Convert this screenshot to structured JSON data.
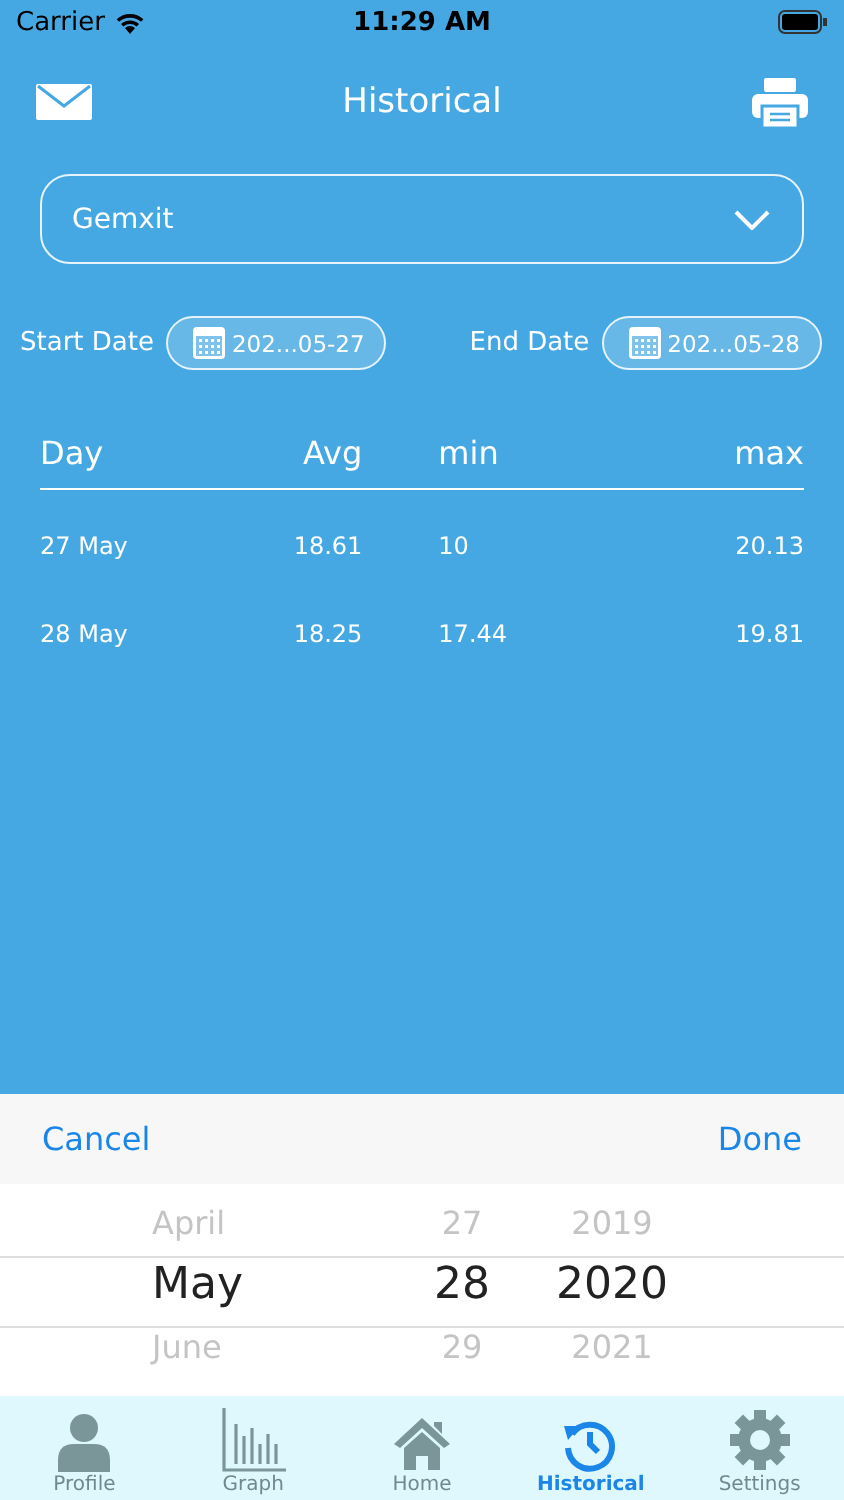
{
  "status_bar": {
    "carrier": "Carrier",
    "time": "11:29 AM"
  },
  "header": {
    "title": "Historical"
  },
  "sensor_dropdown": {
    "value": "Gemxit"
  },
  "date_range": [
    {
      "label": "Start Date",
      "value": "202...05-27"
    },
    {
      "label": "End Date",
      "value": "202...05-28"
    }
  ],
  "table": {
    "columns": [
      "Day",
      "Avg",
      "min",
      "max"
    ],
    "rows": [
      [
        "27 May",
        "18.61",
        "10",
        "20.13"
      ],
      [
        "28 May",
        "18.25",
        "17.44",
        "19.81"
      ]
    ]
  },
  "picker_toolbar": {
    "cancel": "Cancel",
    "done": "Done"
  },
  "picker": {
    "columns": [
      {
        "items": [
          {
            "text": "April",
            "selected": false
          },
          {
            "text": "May",
            "selected": true
          },
          {
            "text": "June",
            "selected": false
          }
        ]
      },
      {
        "items": [
          {
            "text": "27",
            "selected": false
          },
          {
            "text": "28",
            "selected": true
          },
          {
            "text": "29",
            "selected": false
          }
        ]
      },
      {
        "items": [
          {
            "text": "2019",
            "selected": false
          },
          {
            "text": "2020",
            "selected": true
          },
          {
            "text": "2021",
            "selected": false
          }
        ]
      }
    ]
  },
  "tab_bar": [
    {
      "kind": "profile",
      "label": "Profile",
      "selected": false
    },
    {
      "kind": "graph",
      "label": "Graph",
      "selected": false
    },
    {
      "kind": "home",
      "label": "Home",
      "selected": false
    },
    {
      "kind": "historical",
      "label": "Historical",
      "selected": true
    },
    {
      "kind": "settings",
      "label": "Settings",
      "selected": false
    }
  ]
}
